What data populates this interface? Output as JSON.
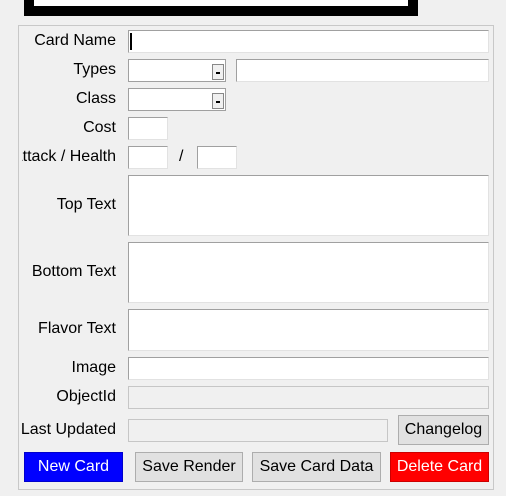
{
  "form": {
    "labels": {
      "card_name": "Card Name",
      "types": "Types",
      "class": "Class",
      "cost": "Cost",
      "attack_health": "Attack / Health",
      "attack_health_separator": "/",
      "top_text": "Top Text",
      "bottom_text": "Bottom Text",
      "flavor_text": "Flavor Text",
      "image": "Image",
      "object_id": "ObjectId",
      "last_updated": "Last Updated"
    },
    "values": {
      "card_name": "",
      "type_primary": "",
      "type_secondary": "",
      "class": "",
      "cost": "",
      "attack": "",
      "health": "",
      "top_text": "",
      "bottom_text": "",
      "flavor_text": "",
      "image": "",
      "object_id": "",
      "last_updated": ""
    }
  },
  "buttons": {
    "changelog": "Changelog",
    "new_card": "New Card",
    "save_render": "Save Render",
    "save_card_data": "Save Card Data",
    "delete_card": "Delete Card"
  },
  "colors": {
    "new_card_bg": "#0000ff",
    "delete_card_bg": "#ff0000"
  }
}
